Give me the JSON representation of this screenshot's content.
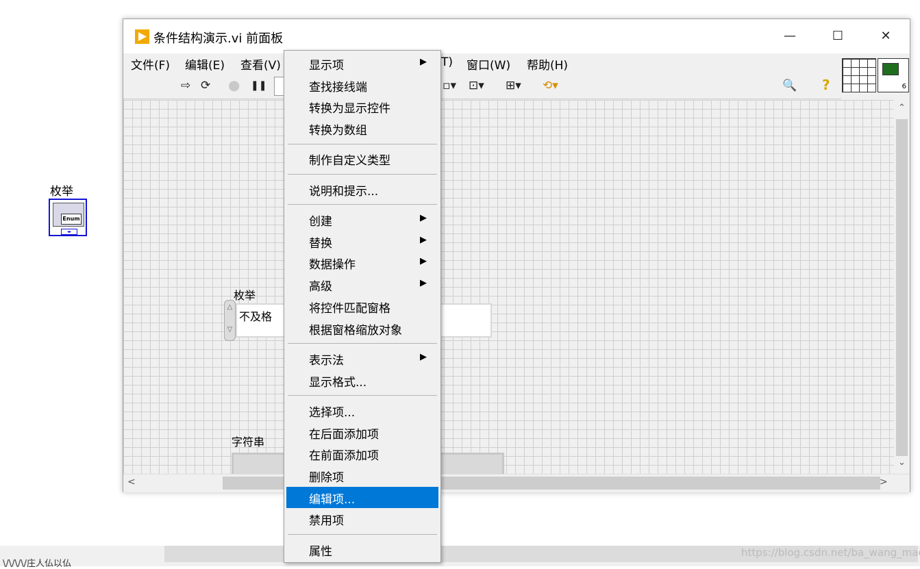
{
  "block_diagram": {
    "enum_label": "枚举",
    "enum_chip": "Enum"
  },
  "window": {
    "title": "条件结构演示.vi 前面板",
    "controls": {
      "minimize": "—",
      "maximize": "☐",
      "close": "✕"
    }
  },
  "menubar": {
    "items": [
      "文件(F)",
      "编辑(E)",
      "查看(V)",
      "T)",
      "窗口(W)",
      "帮助(H)"
    ]
  },
  "toolbar": {
    "run_arrow": "⇨",
    "run_continuous": "⟳",
    "abort": "●",
    "pause": "❚❚",
    "align": "▫▾",
    "distribute": "⊡▾",
    "resize": "⊞▾",
    "reorder": "⟲▾",
    "search": "🔍",
    "help": "?"
  },
  "vi_icon": {
    "number": "6"
  },
  "front_panel": {
    "enum_label": "枚举",
    "enum_value": "不及格",
    "string_label": "字符串"
  },
  "scroll": {
    "up": "⌃",
    "down": "⌄",
    "left": "<",
    "right": ">"
  },
  "context_menu": {
    "groups": [
      [
        {
          "label": "显示项",
          "submenu": true
        },
        {
          "label": "查找接线端",
          "submenu": false
        },
        {
          "label": "转换为显示控件",
          "submenu": false
        },
        {
          "label": "转换为数组",
          "submenu": false
        }
      ],
      [
        {
          "label": "制作自定义类型",
          "submenu": false
        }
      ],
      [
        {
          "label": "说明和提示...",
          "submenu": false
        }
      ],
      [
        {
          "label": "创建",
          "submenu": true
        },
        {
          "label": "替换",
          "submenu": true
        },
        {
          "label": "数据操作",
          "submenu": true
        },
        {
          "label": "高级",
          "submenu": true
        },
        {
          "label": "将控件匹配窗格",
          "submenu": false
        },
        {
          "label": "根据窗格缩放对象",
          "submenu": false
        }
      ],
      [
        {
          "label": "表示法",
          "submenu": true
        },
        {
          "label": "显示格式...",
          "submenu": false
        }
      ],
      [
        {
          "label": "选择项...",
          "submenu": false
        },
        {
          "label": "在后面添加项",
          "submenu": false
        },
        {
          "label": "在前面添加项",
          "submenu": false
        },
        {
          "label": "删除项",
          "submenu": false
        },
        {
          "label": "编辑项...",
          "submenu": false,
          "highlighted": true
        },
        {
          "label": "禁用项",
          "submenu": false
        }
      ],
      [
        {
          "label": "属性",
          "submenu": false
        }
      ]
    ],
    "submenu_arrow": "▶"
  },
  "background": {
    "status_text": "\\/\\/\\/\\/庄人仏以仏"
  },
  "watermark": "https://blog.csdn.net/ba_wang_mao",
  "colors": {
    "highlight": "#0078d7",
    "app_icon": "#f2a900",
    "enum_border": "#1414d6"
  }
}
